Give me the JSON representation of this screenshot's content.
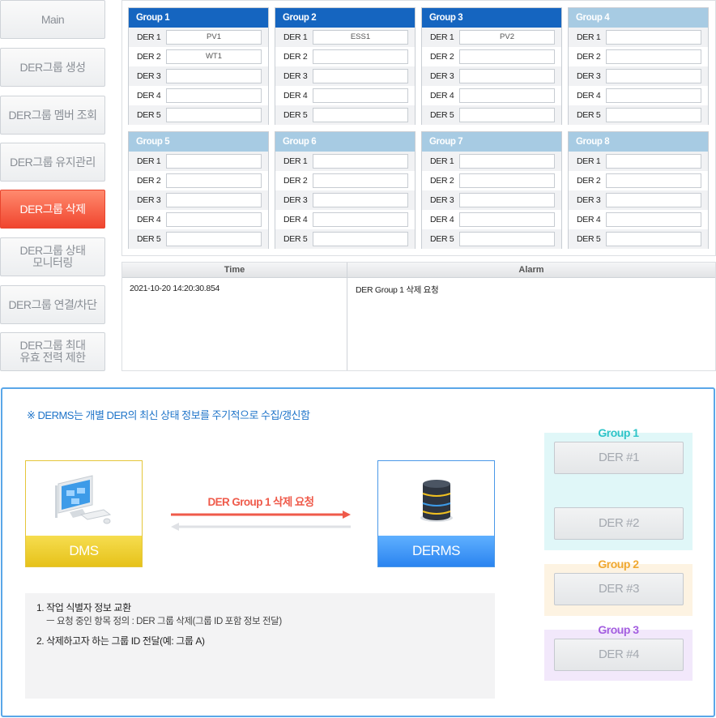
{
  "sidebar": {
    "items": [
      {
        "label": "Main",
        "active": false
      },
      {
        "label": "DER그룹 생성",
        "active": false
      },
      {
        "label": "DER그룹 멤버 조회",
        "active": false
      },
      {
        "label": "DER그룹 유지관리",
        "active": false
      },
      {
        "label": "DER그룹 삭제",
        "active": true
      },
      {
        "label": "DER그룹 상태\n모니터링",
        "active": false
      },
      {
        "label": "DER그룹 연결/차단",
        "active": false
      },
      {
        "label": "DER그룹 최대\n유효 전력 제한",
        "active": false
      }
    ]
  },
  "groups": [
    {
      "name": "Group 1",
      "active": true,
      "ders": [
        {
          "label": "DER 1",
          "value": "PV1"
        },
        {
          "label": "DER 2",
          "value": "WT1"
        },
        {
          "label": "DER 3",
          "value": ""
        },
        {
          "label": "DER 4",
          "value": ""
        },
        {
          "label": "DER 5",
          "value": ""
        }
      ]
    },
    {
      "name": "Group 2",
      "active": true,
      "ders": [
        {
          "label": "DER 1",
          "value": "ESS1"
        },
        {
          "label": "DER 2",
          "value": ""
        },
        {
          "label": "DER 3",
          "value": ""
        },
        {
          "label": "DER 4",
          "value": ""
        },
        {
          "label": "DER 5",
          "value": ""
        }
      ]
    },
    {
      "name": "Group 3",
      "active": true,
      "ders": [
        {
          "label": "DER 1",
          "value": "PV2"
        },
        {
          "label": "DER 2",
          "value": ""
        },
        {
          "label": "DER 3",
          "value": ""
        },
        {
          "label": "DER 4",
          "value": ""
        },
        {
          "label": "DER 5",
          "value": ""
        }
      ]
    },
    {
      "name": "Group 4",
      "active": false,
      "ders": [
        {
          "label": "DER 1",
          "value": ""
        },
        {
          "label": "DER 2",
          "value": ""
        },
        {
          "label": "DER 3",
          "value": ""
        },
        {
          "label": "DER 4",
          "value": ""
        },
        {
          "label": "DER 5",
          "value": ""
        }
      ]
    },
    {
      "name": "Group 5",
      "active": false,
      "ders": [
        {
          "label": "DER 1",
          "value": ""
        },
        {
          "label": "DER 2",
          "value": ""
        },
        {
          "label": "DER 3",
          "value": ""
        },
        {
          "label": "DER 4",
          "value": ""
        },
        {
          "label": "DER 5",
          "value": ""
        }
      ]
    },
    {
      "name": "Group 6",
      "active": false,
      "ders": [
        {
          "label": "DER 1",
          "value": ""
        },
        {
          "label": "DER 2",
          "value": ""
        },
        {
          "label": "DER 3",
          "value": ""
        },
        {
          "label": "DER 4",
          "value": ""
        },
        {
          "label": "DER 5",
          "value": ""
        }
      ]
    },
    {
      "name": "Group 7",
      "active": false,
      "ders": [
        {
          "label": "DER 1",
          "value": ""
        },
        {
          "label": "DER 2",
          "value": ""
        },
        {
          "label": "DER 3",
          "value": ""
        },
        {
          "label": "DER 4",
          "value": ""
        },
        {
          "label": "DER 5",
          "value": ""
        }
      ]
    },
    {
      "name": "Group 8",
      "active": false,
      "ders": [
        {
          "label": "DER 1",
          "value": ""
        },
        {
          "label": "DER 2",
          "value": ""
        },
        {
          "label": "DER 3",
          "value": ""
        },
        {
          "label": "DER 4",
          "value": ""
        },
        {
          "label": "DER 5",
          "value": ""
        }
      ]
    }
  ],
  "alarm_table": {
    "headers": {
      "time": "Time",
      "alarm": "Alarm"
    },
    "rows": [
      {
        "time": "2021-10-20 14:20:30.854",
        "alarm": "DER Group 1 삭제 요청"
      }
    ]
  },
  "diagram": {
    "note": "※ DERMS는 개별 DER의 최신 상태 정보를 주기적으로 수집/갱신함",
    "dms_label": "DMS",
    "derms_label": "DERMS",
    "request_label": "DER Group 1 삭제 요청",
    "info": {
      "item1": "1. 작업 식별자 정보 교환",
      "item1_sub": "ㅡ 요청 중인 항목 정의 : DER 그룹 삭제(그룹 ID 포함 정보 전달)",
      "item2": "2. 삭제하고자 하는 그룹 ID 전달(예: 그룹 A)"
    },
    "group_boxes": [
      {
        "title": "Group 1",
        "ders": [
          "DER #1",
          "DER #2"
        ],
        "color": "#2ec4c8"
      },
      {
        "title": "Group 2",
        "ders": [
          "DER #3"
        ],
        "color": "#f0a830"
      },
      {
        "title": "Group 3",
        "ders": [
          "DER #4"
        ],
        "color": "#a45ee0"
      }
    ]
  },
  "colors": {
    "active_group_header": "#1565c0",
    "inactive_group_header": "#a7cbe3",
    "active_sidebar": "#f0452e",
    "request_arrow": "#ef5a4a",
    "response_arrow": "#dfe1e5"
  }
}
